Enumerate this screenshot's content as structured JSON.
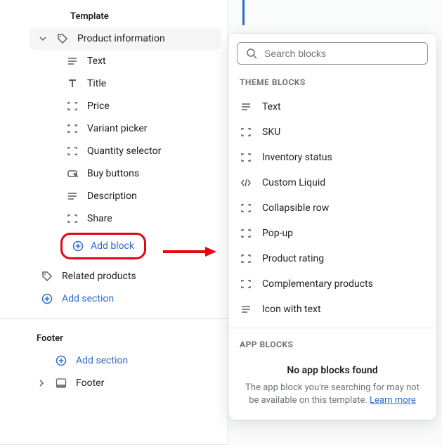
{
  "sidebar": {
    "template_label": "Template",
    "product_info": {
      "title": "Product information",
      "blocks": [
        {
          "label": "Text",
          "icon": "text-lines"
        },
        {
          "label": "Title",
          "icon": "title-t"
        },
        {
          "label": "Price",
          "icon": "block-outline"
        },
        {
          "label": "Variant picker",
          "icon": "block-outline"
        },
        {
          "label": "Quantity selector",
          "icon": "block-outline"
        },
        {
          "label": "Buy buttons",
          "icon": "buy-button"
        },
        {
          "label": "Description",
          "icon": "text-lines"
        },
        {
          "label": "Share",
          "icon": "block-outline"
        }
      ],
      "add_block_label": "Add block"
    },
    "related": {
      "label": "Related products"
    },
    "add_section_label": "Add section",
    "footer_label": "Footer",
    "footer_section": {
      "label": "Footer"
    }
  },
  "popover": {
    "search_placeholder": "Search blocks",
    "theme_heading": "THEME BLOCKS",
    "theme_items": [
      {
        "label": "Text",
        "icon": "text-lines"
      },
      {
        "label": "SKU",
        "icon": "block-outline"
      },
      {
        "label": "Inventory status",
        "icon": "block-outline"
      },
      {
        "label": "Custom Liquid",
        "icon": "code"
      },
      {
        "label": "Collapsible row",
        "icon": "block-outline"
      },
      {
        "label": "Pop-up",
        "icon": "block-outline"
      },
      {
        "label": "Product rating",
        "icon": "block-outline"
      },
      {
        "label": "Complementary products",
        "icon": "block-outline"
      },
      {
        "label": "Icon with text",
        "icon": "text-lines"
      }
    ],
    "app_heading": "APP BLOCKS",
    "app_empty_title": "No app blocks found",
    "app_empty_desc": "The app block you're searching for may not be available on this template. ",
    "learn_more": "Learn more"
  }
}
